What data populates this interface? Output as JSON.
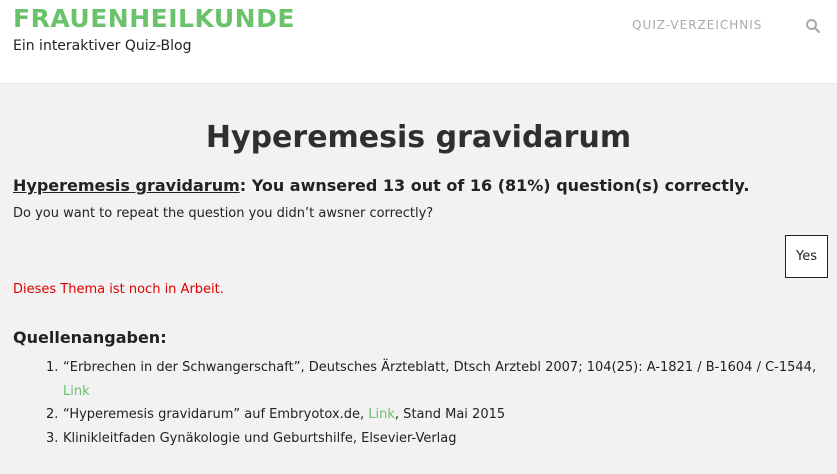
{
  "header": {
    "site_title": "FRAUENHEILKUNDE",
    "tagline": "Ein interaktiver Quiz-Blog",
    "nav_link": "QUIZ-VERZEICHNIS",
    "search_icon": "search-icon"
  },
  "main": {
    "page_title": "Hyperemesis gravidarum",
    "result": {
      "quiz_name": "Hyperemesis gravidarum",
      "text": ": You awnsered 13 out of 16 (81%) question(s) correctly."
    },
    "question": "Do you want to repeat the question you didn’t awsner correctly?",
    "yes_button": "Yes",
    "notice": "Dieses Thema ist noch in Arbeit.",
    "notice_color": "#e00000",
    "sources_heading": "Quellenangaben:",
    "sources": [
      {
        "num": "1.",
        "text": "“Erbrechen in der Schwangerschaft”, Deutsches Ärzteblatt, Dtsch Arztebl 2007; 104(25): A-1821 / B-1604 / C-1544, ",
        "link": "Link",
        "after": ""
      },
      {
        "num": "2.",
        "text": "“Hyperemesis gravidarum” auf Embryotox.de, ",
        "link": "Link",
        "after": ", Stand Mai 2015"
      },
      {
        "num": "3.",
        "text": "Klinikleitfaden Gynäkologie und Geburtshilfe, Elsevier-Verlag",
        "link": "",
        "after": ""
      }
    ]
  },
  "colors": {
    "accent": "#6ac36a",
    "background": "#f2f2f2",
    "header_bg": "#ffffff"
  }
}
